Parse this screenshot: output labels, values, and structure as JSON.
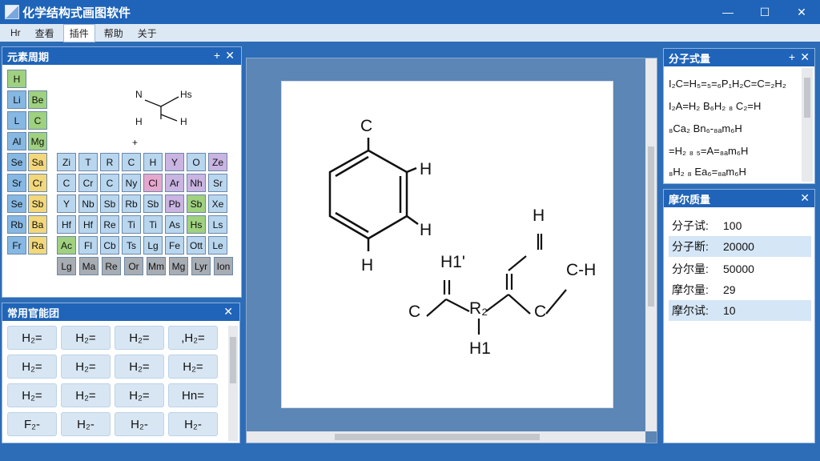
{
  "window": {
    "title": "化学结构式画图软件",
    "controls": {
      "minimize": "—",
      "maximize": "☐",
      "close": "✕"
    }
  },
  "menu": [
    "Hr",
    "查看",
    "插件",
    "帮助",
    "关于"
  ],
  "periodic_panel": {
    "title": "元素周期",
    "pin": "+",
    "close": "✕",
    "elements": [
      [
        "H"
      ],
      [
        "Li",
        "Be"
      ],
      [
        "L",
        "C"
      ],
      [
        "Al",
        "Mg"
      ],
      [
        "Se",
        "Sa",
        "Zi",
        "T",
        "R",
        "C",
        "H",
        "Y",
        "O",
        "Ze"
      ],
      [
        "Sr",
        "Cr",
        "C",
        "Cr",
        "C",
        "Ny",
        "Cl",
        "Ar",
        "Nh",
        "Sr"
      ],
      [
        "Se",
        "Sb",
        "Y",
        "Nb",
        "Sb",
        "Rb",
        "Sb",
        "Pb",
        "Sb",
        "Xe"
      ],
      [
        "Rb",
        "Ba",
        "Hf",
        "Hf",
        "Re",
        "Ti",
        "Ti",
        "As",
        "Hs",
        "Ls"
      ],
      [
        "Fr",
        "Ra",
        "Ac",
        "Fl",
        "Cb",
        "Ts",
        "Lg",
        "Fe",
        "Ott",
        "Le"
      ],
      [
        "Lg",
        "Ma",
        "Re",
        "Or",
        "Mm",
        "Mg",
        "Lyr",
        "Ion"
      ]
    ],
    "snippet": {
      "n": "N",
      "h1": "Hs",
      "h2": "H",
      "h3": "H",
      "plus": "+"
    }
  },
  "groups_panel": {
    "title": "常用官能团",
    "close": "✕",
    "buttons": [
      "H₂=",
      "H₂=",
      "H₂=",
      ",H₂=",
      "H₂=",
      "H₂=",
      "H₂=",
      "H₂=",
      "H₂=",
      "H₂=",
      "H₂=",
      "Hn=",
      "F₂-",
      "H₂-",
      "H₂-",
      "H₂-"
    ]
  },
  "canvas": {
    "structure_labels": {
      "top_c": "C",
      "ring_h1": "H",
      "ring_h2": "H",
      "ring_h3": "H",
      "chain_h_top": "H",
      "chain_h1": "H1'",
      "chain_c_left": "C",
      "chain_r2": "R₂",
      "chain_h_bottom": "H1",
      "chain_c_mid": "C",
      "chain_ch": "C-H"
    }
  },
  "formula_panel": {
    "title": "分子式量",
    "pin": "+",
    "close": "✕",
    "lines": [
      "I₂C=H₅=₅=₆P₁H₂C=C=₂H₂",
      "I₂A=H₂ B₆H₂   ₈ C₂=H",
      "₈Ca₂  Bn₆-₈ₐm₆H",
      "=H₂ ₈ ₅=A=₈ₐm₆H",
      "₈H₂  ₈ Ea₆=₈ₐm₆H"
    ]
  },
  "molar_panel": {
    "title": "摩尔质量",
    "close": "✕",
    "rows": [
      {
        "label": "分子试:",
        "value": "100"
      },
      {
        "label": "分子断:",
        "value": "20000"
      },
      {
        "label": "分尔量:",
        "value": "50000"
      },
      {
        "label": "摩尔量:",
        "value": "29"
      },
      {
        "label": "摩尔试:",
        "value": "10"
      }
    ]
  },
  "colors": {
    "accent": "#1f64b8",
    "canvas_bg": "#5c86b6",
    "row_highlight": "#d5e6f6"
  }
}
